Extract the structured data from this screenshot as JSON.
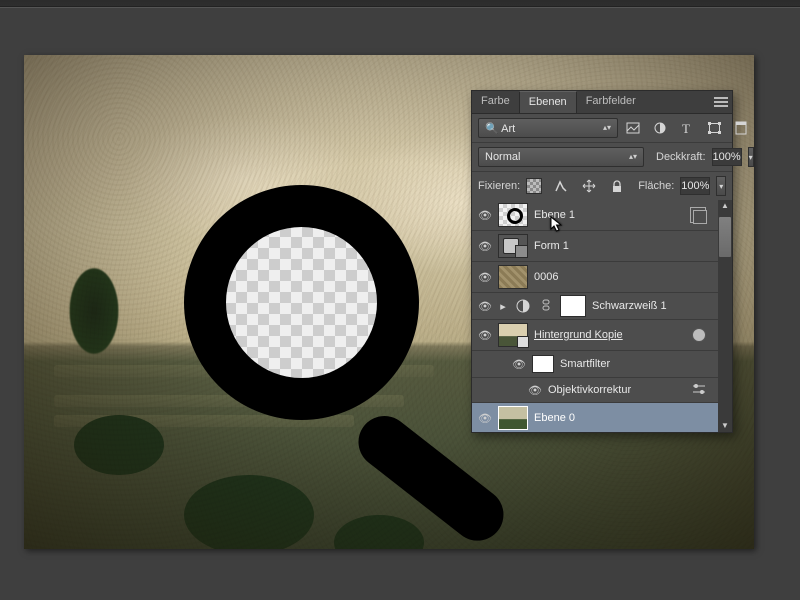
{
  "tabs": {
    "color": "Farbe",
    "layers": "Ebenen",
    "swatches": "Farbfelder"
  },
  "filter_kind": {
    "icon": "🔍",
    "label": "Art"
  },
  "type_icons": [
    "image-icon",
    "adjustment-icon",
    "type-icon",
    "shape-icon",
    "smartobject-icon"
  ],
  "blend_mode": "Normal",
  "opacity_label": "Deckkraft:",
  "opacity_value": "100%",
  "fill_label": "Fläche:",
  "fill_value": "100%",
  "lock_label": "Fixieren:",
  "layers": {
    "l1": "Ebene 1",
    "l2": "Form 1",
    "l3": "0006",
    "l4": "Schwarzweiß 1",
    "l5": "Hintergrund Kopie",
    "l5a": "Smartfilter",
    "l5b": "Objektivkorrektur",
    "l6": "Ebene 0"
  }
}
